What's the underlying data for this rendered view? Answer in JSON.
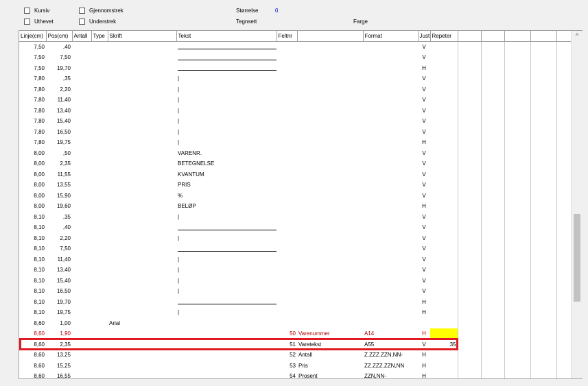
{
  "options": {
    "kursiv": "Kursiv",
    "gjennomstrek": "Gjennomstrek",
    "uthevet": "Uthevet",
    "understrek": "Understrek",
    "storrelse_label": "Størrelse",
    "storrelse_value": "0",
    "tegnsett_label": "Tegnsett",
    "farge_label": "Farge"
  },
  "columns": [
    "Linje(cm)",
    "Pos(cm)",
    "Antall",
    "Type",
    "Skrift",
    "Tekst",
    "Feltnr",
    "",
    "Format",
    "Just.",
    "Repeter",
    "",
    "",
    "",
    "",
    ""
  ],
  "rows": [
    {
      "linje": "7,50",
      "pos": ",40",
      "skrift": "",
      "tekst": "",
      "line": true,
      "feltnr": "",
      "navn": "",
      "format": "",
      "just": "V",
      "repeter": ""
    },
    {
      "linje": "7,50",
      "pos": "7,50",
      "skrift": "",
      "tekst": "",
      "line": true,
      "feltnr": "",
      "navn": "",
      "format": "",
      "just": "V",
      "repeter": ""
    },
    {
      "linje": "7,50",
      "pos": "19,70",
      "skrift": "",
      "tekst": "",
      "line": true,
      "feltnr": "",
      "navn": "",
      "format": "",
      "just": "H",
      "repeter": ""
    },
    {
      "linje": "7,80",
      "pos": ",35",
      "skrift": "",
      "tekst": "|",
      "line": false,
      "feltnr": "",
      "navn": "",
      "format": "",
      "just": "V",
      "repeter": ""
    },
    {
      "linje": "7,80",
      "pos": "2,20",
      "skrift": "",
      "tekst": "|",
      "line": false,
      "feltnr": "",
      "navn": "",
      "format": "",
      "just": "V",
      "repeter": ""
    },
    {
      "linje": "7,80",
      "pos": "11,40",
      "skrift": "",
      "tekst": "|",
      "line": false,
      "feltnr": "",
      "navn": "",
      "format": "",
      "just": "V",
      "repeter": ""
    },
    {
      "linje": "7,80",
      "pos": "13,40",
      "skrift": "",
      "tekst": "|",
      "line": false,
      "feltnr": "",
      "navn": "",
      "format": "",
      "just": "V",
      "repeter": ""
    },
    {
      "linje": "7,80",
      "pos": "15,40",
      "skrift": "",
      "tekst": "|",
      "line": false,
      "feltnr": "",
      "navn": "",
      "format": "",
      "just": "V",
      "repeter": ""
    },
    {
      "linje": "7,80",
      "pos": "16,50",
      "skrift": "",
      "tekst": "|",
      "line": false,
      "feltnr": "",
      "navn": "",
      "format": "",
      "just": "V",
      "repeter": ""
    },
    {
      "linje": "7,80",
      "pos": "19,75",
      "skrift": "",
      "tekst": "|",
      "line": false,
      "feltnr": "",
      "navn": "",
      "format": "",
      "just": "H",
      "repeter": ""
    },
    {
      "linje": "8,00",
      "pos": ",50",
      "skrift": "",
      "tekst": "VARENR.",
      "line": false,
      "feltnr": "",
      "navn": "",
      "format": "",
      "just": "V",
      "repeter": ""
    },
    {
      "linje": "8,00",
      "pos": "2,35",
      "skrift": "",
      "tekst": "BETEGNELSE",
      "line": false,
      "feltnr": "",
      "navn": "",
      "format": "",
      "just": "V",
      "repeter": ""
    },
    {
      "linje": "8,00",
      "pos": "11,55",
      "skrift": "",
      "tekst": "KVANTUM",
      "line": false,
      "feltnr": "",
      "navn": "",
      "format": "",
      "just": "V",
      "repeter": ""
    },
    {
      "linje": "8,00",
      "pos": "13,55",
      "skrift": "",
      "tekst": "PRIS",
      "line": false,
      "feltnr": "",
      "navn": "",
      "format": "",
      "just": "V",
      "repeter": ""
    },
    {
      "linje": "8,00",
      "pos": "15,90",
      "skrift": "",
      "tekst": "%",
      "line": false,
      "feltnr": "",
      "navn": "",
      "format": "",
      "just": "V",
      "repeter": ""
    },
    {
      "linje": "8,00",
      "pos": "19,60",
      "skrift": "",
      "tekst": "BELØP",
      "line": false,
      "feltnr": "",
      "navn": "",
      "format": "",
      "just": "H",
      "repeter": ""
    },
    {
      "linje": "8,10",
      "pos": ",35",
      "skrift": "",
      "tekst": "|",
      "line": false,
      "feltnr": "",
      "navn": "",
      "format": "",
      "just": "V",
      "repeter": ""
    },
    {
      "linje": "8,10",
      "pos": ",40",
      "skrift": "",
      "tekst": "",
      "line": true,
      "feltnr": "",
      "navn": "",
      "format": "",
      "just": "V",
      "repeter": ""
    },
    {
      "linje": "8,10",
      "pos": "2,20",
      "skrift": "",
      "tekst": "|",
      "line": false,
      "feltnr": "",
      "navn": "",
      "format": "",
      "just": "V",
      "repeter": ""
    },
    {
      "linje": "8,10",
      "pos": "7,50",
      "skrift": "",
      "tekst": "",
      "line": true,
      "feltnr": "",
      "navn": "",
      "format": "",
      "just": "V",
      "repeter": ""
    },
    {
      "linje": "8,10",
      "pos": "11,40",
      "skrift": "",
      "tekst": "|",
      "line": false,
      "feltnr": "",
      "navn": "",
      "format": "",
      "just": "V",
      "repeter": ""
    },
    {
      "linje": "8,10",
      "pos": "13,40",
      "skrift": "",
      "tekst": "|",
      "line": false,
      "feltnr": "",
      "navn": "",
      "format": "",
      "just": "V",
      "repeter": ""
    },
    {
      "linje": "8,10",
      "pos": "15,40",
      "skrift": "",
      "tekst": "|",
      "line": false,
      "feltnr": "",
      "navn": "",
      "format": "",
      "just": "V",
      "repeter": ""
    },
    {
      "linje": "8,10",
      "pos": "16,50",
      "skrift": "",
      "tekst": "|",
      "line": false,
      "feltnr": "",
      "navn": "",
      "format": "",
      "just": "V",
      "repeter": ""
    },
    {
      "linje": "8,10",
      "pos": "19,70",
      "skrift": "",
      "tekst": "",
      "line": true,
      "feltnr": "",
      "navn": "",
      "format": "",
      "just": "H",
      "repeter": ""
    },
    {
      "linje": "8,10",
      "pos": "19,75",
      "skrift": "",
      "tekst": "|",
      "line": false,
      "feltnr": "",
      "navn": "",
      "format": "",
      "just": "H",
      "repeter": ""
    },
    {
      "linje": "8,60",
      "pos": "1,00",
      "skrift": "Arial",
      "tekst": "",
      "line": false,
      "feltnr": "",
      "navn": "",
      "format": "",
      "just": "",
      "repeter": ""
    },
    {
      "linje": "8,60",
      "pos": "1,90",
      "skrift": "",
      "tekst": "",
      "line": false,
      "feltnr": "50",
      "navn": "Varenummer",
      "format": "A14",
      "just": "H",
      "repeter": "",
      "red": true,
      "yellow": true
    },
    {
      "linje": "8,60",
      "pos": "2,35",
      "skrift": "",
      "tekst": "",
      "line": false,
      "feltnr": "51",
      "navn": "Varetekst",
      "format": "A55",
      "just": "V",
      "repeter": "35"
    },
    {
      "linje": "8,60",
      "pos": "13,25",
      "skrift": "",
      "tekst": "",
      "line": false,
      "feltnr": "52",
      "navn": "Antall",
      "format": "Z.ZZZ.ZZN,NN-",
      "just": "H",
      "repeter": ""
    },
    {
      "linje": "8,60",
      "pos": "15,25",
      "skrift": "",
      "tekst": "",
      "line": false,
      "feltnr": "53",
      "navn": "Pris",
      "format": "ZZ.ZZZ.ZZN,NN",
      "just": "H",
      "repeter": ""
    },
    {
      "linje": "8,60",
      "pos": "16,55",
      "skrift": "",
      "tekst": "",
      "line": false,
      "feltnr": "54",
      "navn": "Prosent",
      "format": "ZZN,NN-",
      "just": "H",
      "repeter": ""
    }
  ],
  "scrollbar": {
    "up_icon": "^"
  }
}
